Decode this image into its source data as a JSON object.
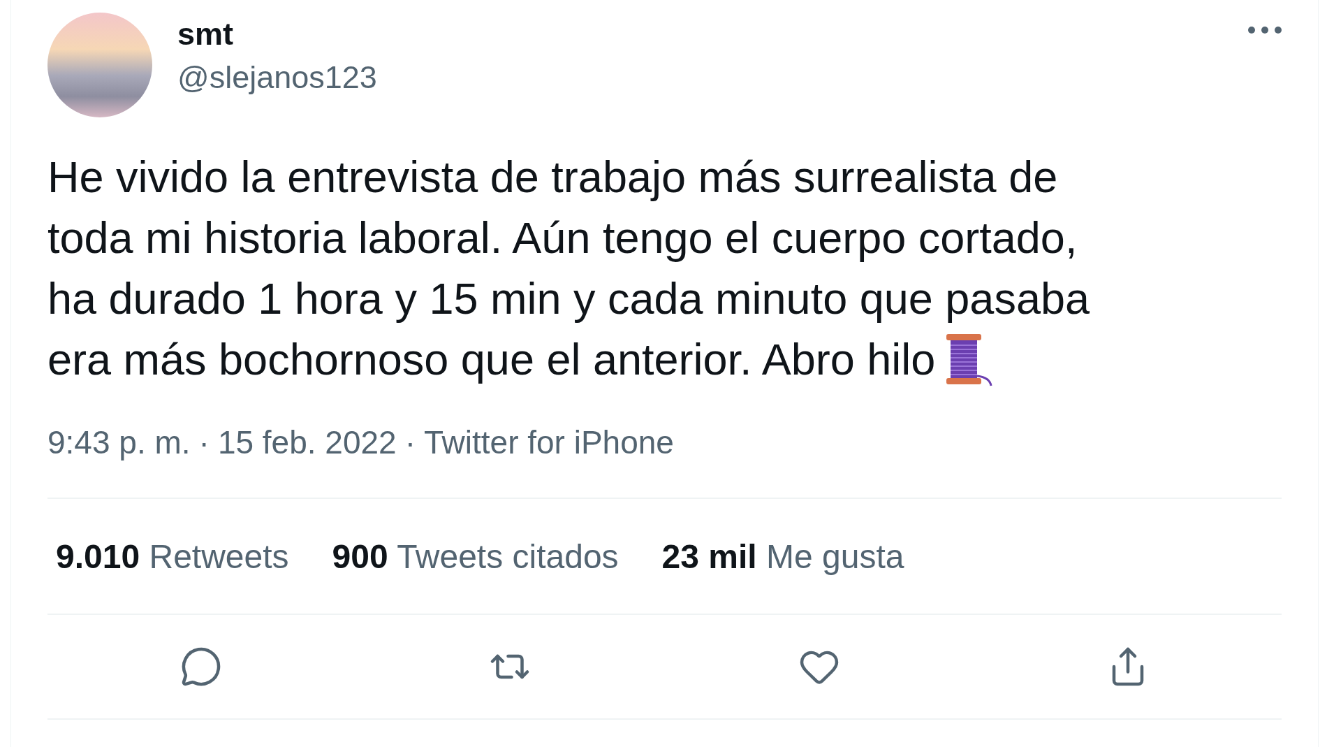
{
  "author": {
    "name": "smt",
    "handle": "@slejanos123"
  },
  "tweet": {
    "lines": [
      "He vivido la entrevista de trabajo más surrealista de",
      "toda mi historia laboral. Aún tengo el cuerpo cortado,",
      "ha durado 1 hora y 15 min y cada minuto que pasaba",
      "era más bochornoso que el anterior. Abro hilo"
    ]
  },
  "meta": {
    "time": "9:43 p. m.",
    "separator": "·",
    "date": "15 feb. 2022",
    "source": "Twitter for iPhone"
  },
  "stats": [
    {
      "count": "9.010",
      "label": "Retweets"
    },
    {
      "count": "900",
      "label": "Tweets citados"
    },
    {
      "count": "23 mil",
      "label": "Me gusta"
    }
  ],
  "actions": [
    {
      "kind": "reply"
    },
    {
      "kind": "retweet"
    },
    {
      "kind": "like"
    },
    {
      "kind": "share"
    }
  ]
}
